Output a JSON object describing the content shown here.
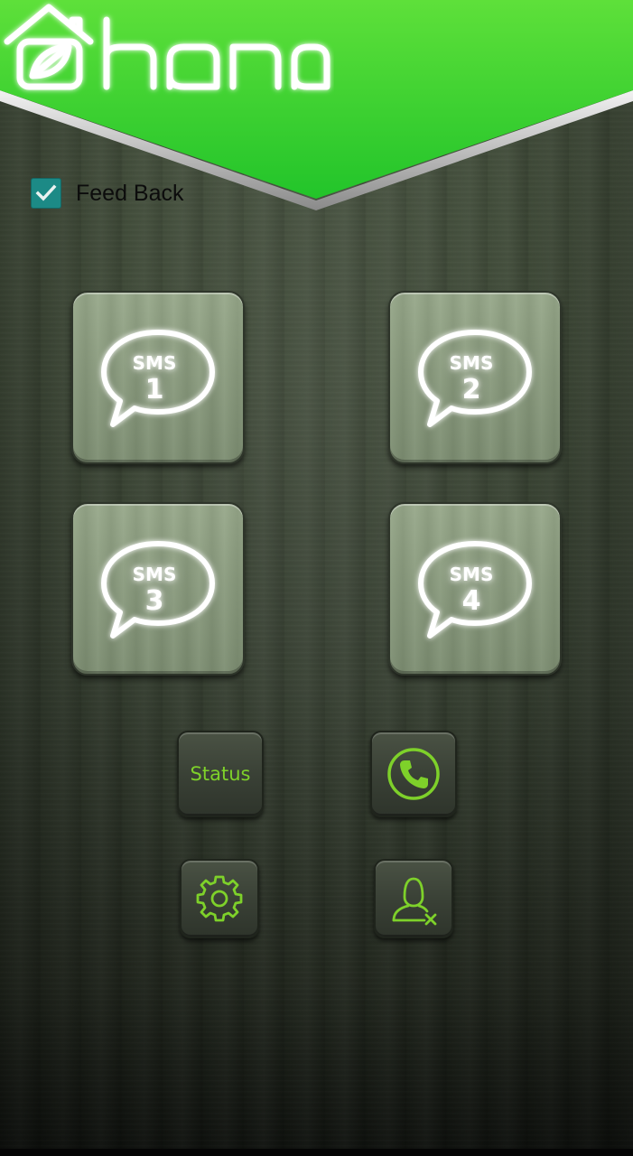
{
  "app": {
    "brand": "hana",
    "accent_color": "#4fd12a"
  },
  "feedback": {
    "label": "Feed Back",
    "checked": true
  },
  "sms_tiles": [
    {
      "label": "SMS",
      "number": "1"
    },
    {
      "label": "SMS",
      "number": "2"
    },
    {
      "label": "SMS",
      "number": "3"
    },
    {
      "label": "SMS",
      "number": "4"
    }
  ],
  "controls": {
    "status_label": "Status",
    "call_icon": "phone-icon",
    "settings_icon": "gear-icon",
    "remove_user_icon": "remove-user-icon"
  }
}
